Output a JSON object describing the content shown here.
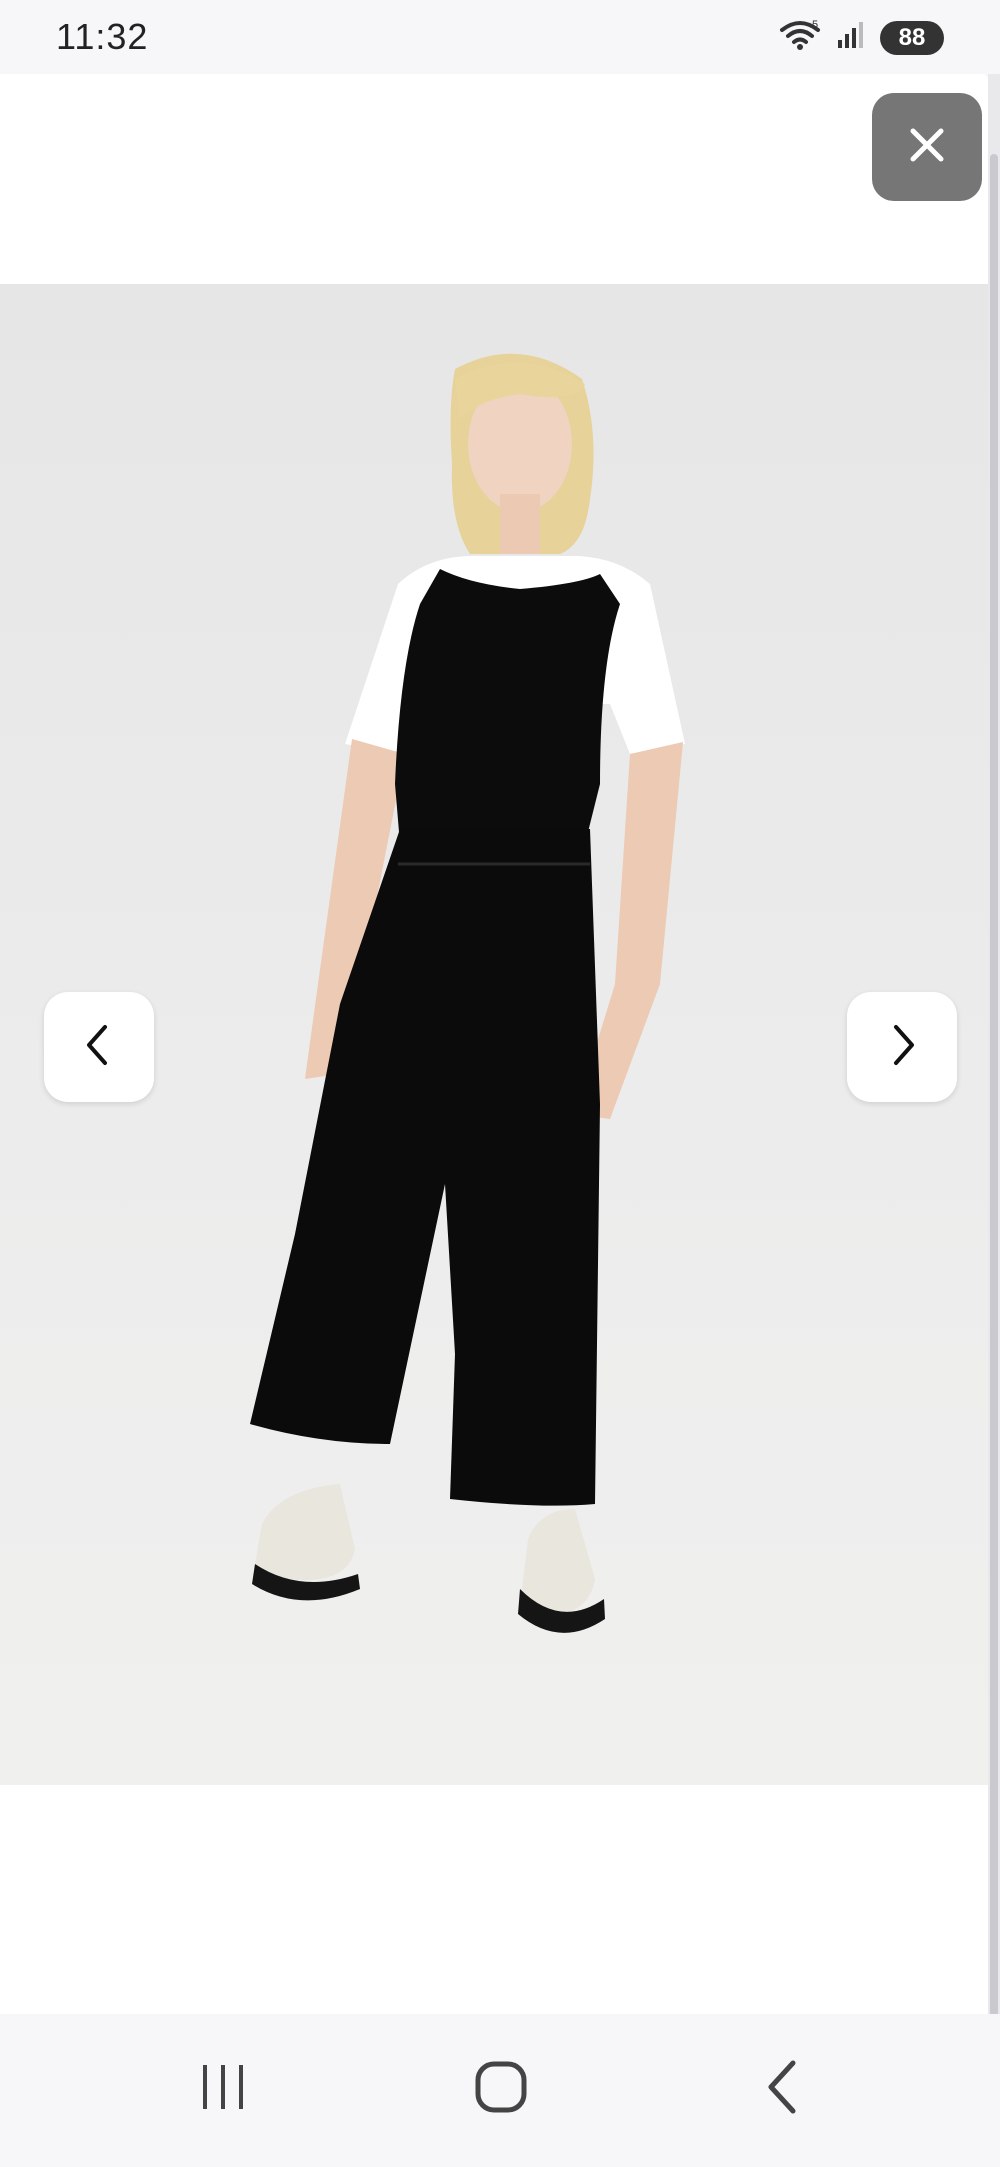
{
  "status_bar": {
    "time": "11:32",
    "battery": "88",
    "icons": [
      "wifi-icon",
      "signal-icon",
      "battery-icon"
    ]
  },
  "viewer": {
    "close_icon": "close-icon",
    "prev_icon": "chevron-left-icon",
    "next_icon": "chevron-right-icon",
    "image_subject": "product-photo"
  },
  "system_nav": {
    "icons": [
      "recent-apps-icon",
      "home-icon",
      "back-icon"
    ]
  }
}
